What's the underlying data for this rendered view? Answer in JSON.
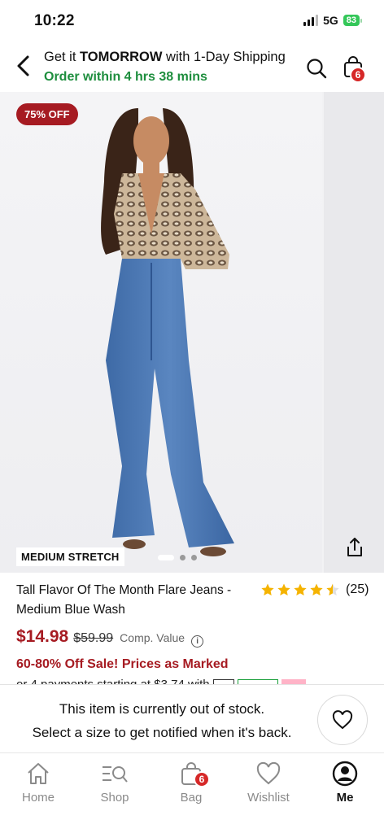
{
  "status_bar": {
    "time": "10:22",
    "network": "5G",
    "battery": "83"
  },
  "header": {
    "shipping_prefix": "Get it ",
    "shipping_bold": "TOMORROW",
    "shipping_suffix": " with 1-Day Shipping",
    "order_within": "Order within 4 hrs 38 mins",
    "bag_count": "6"
  },
  "gallery": {
    "discount_badge": "75% OFF",
    "fit_tag": "MEDIUM STRETCH",
    "slide_count": 3,
    "active_slide": 1
  },
  "product": {
    "title": "Tall Flavor Of The Month Flare Jeans - Medium Blue Wash",
    "rating_stars": 4.5,
    "review_count": "(25)",
    "price": "$14.98",
    "original_price": "$59.99",
    "comp_label": "Comp. Value",
    "promo": "60-80% Off Sale! Prices as Marked",
    "installments": "or 4 payments starting at $3.74 with"
  },
  "stock_notice": {
    "line1": "This item is currently out of stock.",
    "line2": "Select a size to get notified when it's back."
  },
  "nav": {
    "items": [
      {
        "label": "Home",
        "icon": "home-icon"
      },
      {
        "label": "Shop",
        "icon": "shop-icon"
      },
      {
        "label": "Bag",
        "icon": "bag-icon",
        "badge": "6"
      },
      {
        "label": "Wishlist",
        "icon": "heart-icon"
      },
      {
        "label": "Me",
        "icon": "profile-icon",
        "active": true
      }
    ]
  },
  "colors": {
    "accent_red": "#a61b22",
    "shipping_green": "#1e8e3e",
    "star_gold": "#f5b301",
    "badge_red": "#d62828"
  }
}
